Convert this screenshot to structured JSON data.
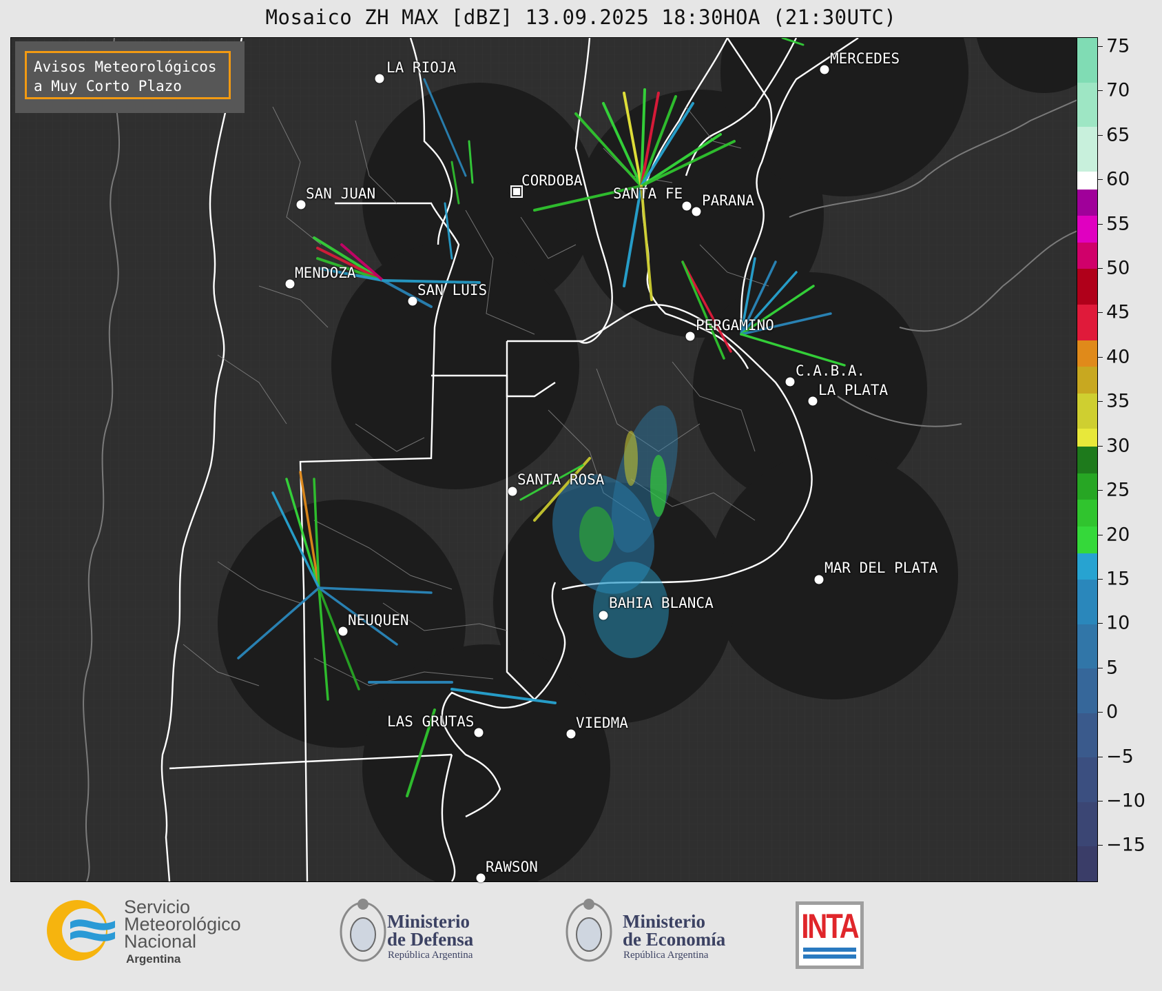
{
  "title": "Mosaico ZH MAX [dBZ] 13.09.2025 18:30HOA (21:30UTC)",
  "alert_box": {
    "line1": "Avisos Meteorológicos",
    "line2": "a Muy Corto Plazo",
    "border_color": "#f29a12"
  },
  "cities": [
    {
      "name": "LA RIOJA"
    },
    {
      "name": "MERCEDES"
    },
    {
      "name": "CORDOBA"
    },
    {
      "name": "SAN JUAN"
    },
    {
      "name": "SANTA FE"
    },
    {
      "name": "PARANA"
    },
    {
      "name": "MENDOZA"
    },
    {
      "name": "SAN LUIS"
    },
    {
      "name": "PERGAMINO"
    },
    {
      "name": "C.A.B.A."
    },
    {
      "name": "LA PLATA"
    },
    {
      "name": "SANTA ROSA"
    },
    {
      "name": "MAR DEL PLATA"
    },
    {
      "name": "BAHIA BLANCA"
    },
    {
      "name": "NEUQUEN"
    },
    {
      "name": "LAS GRUTAS"
    },
    {
      "name": "VIEDMA"
    },
    {
      "name": "RAWSON"
    }
  ],
  "colorbar": {
    "unit": "dBZ",
    "min": -19,
    "max": 76,
    "ticks": [
      "75",
      "70",
      "65",
      "60",
      "55",
      "50",
      "45",
      "40",
      "35",
      "30",
      "25",
      "20",
      "15",
      "10",
      "5",
      "0",
      "−5",
      "−10",
      "−15"
    ],
    "segments": [
      {
        "from": -19,
        "to": -15,
        "color": "#3a3d68"
      },
      {
        "from": -15,
        "to": -10,
        "color": "#3b4674"
      },
      {
        "from": -10,
        "to": -5,
        "color": "#3b4f80"
      },
      {
        "from": -5,
        "to": 0,
        "color": "#3a5a8c"
      },
      {
        "from": 0,
        "to": 5,
        "color": "#36679a"
      },
      {
        "from": 5,
        "to": 10,
        "color": "#3176a8"
      },
      {
        "from": 10,
        "to": 15,
        "color": "#2a87bb"
      },
      {
        "from": 15,
        "to": 18,
        "color": "#27a3d1"
      },
      {
        "from": 18,
        "to": 21,
        "color": "#35d83a"
      },
      {
        "from": 21,
        "to": 24,
        "color": "#30c42e"
      },
      {
        "from": 24,
        "to": 27,
        "color": "#27a624"
      },
      {
        "from": 27,
        "to": 30,
        "color": "#1e7a1c"
      },
      {
        "from": 30,
        "to": 32,
        "color": "#e8e83a"
      },
      {
        "from": 32,
        "to": 36,
        "color": "#cfcf30"
      },
      {
        "from": 36,
        "to": 39,
        "color": "#c8a820"
      },
      {
        "from": 39,
        "to": 42,
        "color": "#e08a1a"
      },
      {
        "from": 42,
        "to": 46,
        "color": "#e01a3a"
      },
      {
        "from": 46,
        "to": 50,
        "color": "#b0001a"
      },
      {
        "from": 50,
        "to": 53,
        "color": "#d0006a"
      },
      {
        "from": 53,
        "to": 56,
        "color": "#e000c0"
      },
      {
        "from": 56,
        "to": 59,
        "color": "#a0009a"
      },
      {
        "from": 59,
        "to": 61,
        "color": "#ffffff"
      },
      {
        "from": 61,
        "to": 66,
        "color": "#c8f0dc"
      },
      {
        "from": 66,
        "to": 71,
        "color": "#9ee6c4"
      },
      {
        "from": 71,
        "to": 76,
        "color": "#80dcb4"
      }
    ]
  },
  "logos": {
    "smn_line1": "Servicio",
    "smn_line2": "Meteorológico",
    "smn_line3": "Nacional",
    "smn_sub": "Argentina",
    "defensa_line1": "Ministerio",
    "defensa_line2": "de Defensa",
    "defensa_sub": "República Argentina",
    "economia_line1": "Ministerio",
    "economia_line2": "de Economía",
    "economia_sub": "República Argentina",
    "inta": "INTA"
  }
}
